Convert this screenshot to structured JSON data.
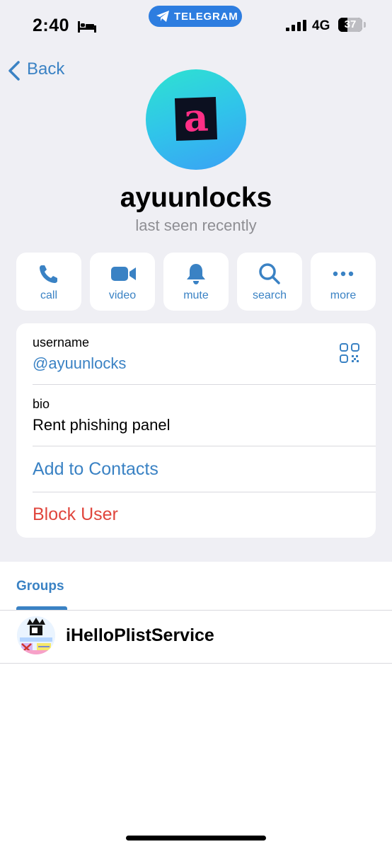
{
  "status_bar": {
    "time": "2:40",
    "focus_icon": "bed-icon",
    "app_pill": "TELEGRAM",
    "network": "4G",
    "battery": "37",
    "battery_level": 0.37
  },
  "nav": {
    "back_label": "Back"
  },
  "profile": {
    "avatar_letter": "a",
    "name": "ayuunlocks",
    "status": "last seen recently"
  },
  "actions": [
    {
      "label": "call",
      "icon": "phone-icon"
    },
    {
      "label": "video",
      "icon": "video-icon"
    },
    {
      "label": "mute",
      "icon": "bell-icon"
    },
    {
      "label": "search",
      "icon": "search-icon"
    },
    {
      "label": "more",
      "icon": "more-icon"
    }
  ],
  "info": {
    "username_label": "username",
    "username_value": "@ayuunlocks",
    "bio_label": "bio",
    "bio_value": "Rent phishing panel",
    "add_contacts": "Add to Contacts",
    "block_user": "Block User"
  },
  "tabs": {
    "groups": "Groups"
  },
  "groups": [
    {
      "name": "iHelloPlistService"
    }
  ],
  "colors": {
    "accent": "#3a82c4",
    "danger": "#e0463d",
    "background": "#efeff4",
    "telegram_pill": "#2d7de0"
  }
}
